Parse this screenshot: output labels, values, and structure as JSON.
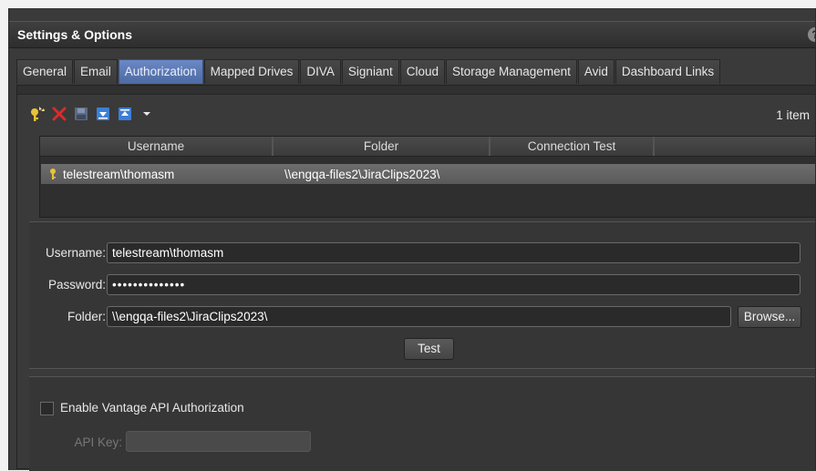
{
  "window": {
    "title": "Settings & Options",
    "help_label": "?"
  },
  "tabs": [
    {
      "label": "General",
      "active": false
    },
    {
      "label": "Email",
      "active": false
    },
    {
      "label": "Authorization",
      "active": true
    },
    {
      "label": "Mapped Drives",
      "active": false
    },
    {
      "label": "DIVA",
      "active": false
    },
    {
      "label": "Signiant",
      "active": false
    },
    {
      "label": "Cloud",
      "active": false
    },
    {
      "label": "Storage Management",
      "active": false
    },
    {
      "label": "Avid",
      "active": false
    },
    {
      "label": "Dashboard Links",
      "active": false
    }
  ],
  "toolbar": {
    "icons": [
      "add-key-icon",
      "delete-icon",
      "save-icon",
      "move-down-icon",
      "move-up-icon",
      "dropdown-arrow-icon"
    ],
    "item_count": "1 item"
  },
  "grid": {
    "columns": [
      "Username",
      "Folder",
      "Connection Test"
    ],
    "rows": [
      {
        "username": "telestream\\thomasm",
        "folder": "\\\\engqa-files2\\JiraClips2023\\",
        "connection_test": ""
      }
    ]
  },
  "form": {
    "username_label": "Username:",
    "username_value": "telestream\\thomasm",
    "password_label": "Password:",
    "password_value": "••••••••••••••",
    "folder_label": "Folder:",
    "folder_value": "\\\\engqa-files2\\JiraClips2023\\",
    "browse_label": "Browse...",
    "test_label": "Test"
  },
  "api": {
    "enable_label": "Enable Vantage API Authorization",
    "enabled": false,
    "api_key_label": "API Key:",
    "api_key_value": ""
  },
  "colors": {
    "accent_tab": "#5a78b5",
    "key_icon": "#e8c33a",
    "delete_icon": "#d92b2b",
    "arrow_icon": "#3d7fd6"
  }
}
